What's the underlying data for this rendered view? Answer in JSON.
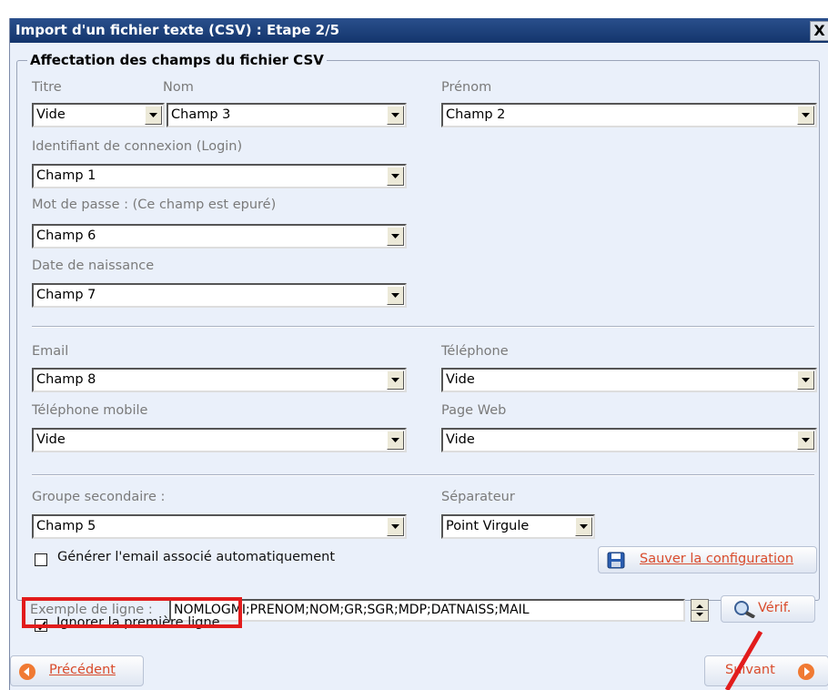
{
  "window": {
    "title": "Import d'un fichier texte (CSV) : Etape 2/5",
    "close_label": "X"
  },
  "group": {
    "legend": "Affectation des champs du fichier CSV"
  },
  "fields": {
    "titre": {
      "label": "Titre",
      "value": "Vide"
    },
    "nom": {
      "label": "Nom",
      "value": "Champ 3"
    },
    "prenom": {
      "label": "Prénom",
      "value": "Champ 2"
    },
    "login": {
      "label": "Identifiant de connexion (Login)",
      "value": "Champ 1"
    },
    "password": {
      "label": "Mot de passe : (Ce champ est epuré)",
      "value": "Champ 6"
    },
    "birthdate": {
      "label": "Date de naissance",
      "value": "Champ 7"
    },
    "email": {
      "label": "Email",
      "value": "Champ 8"
    },
    "telephone": {
      "label": "Téléphone",
      "value": "Vide"
    },
    "mobile": {
      "label": "Téléphone mobile",
      "value": "Vide"
    },
    "web": {
      "label": "Page Web",
      "value": "Vide"
    },
    "groupe": {
      "label": "Groupe secondaire :",
      "value": "Champ 5"
    },
    "separateur": {
      "label": "Séparateur",
      "value": "Point Virgule"
    }
  },
  "generate_email": {
    "label": "Générer l'email associé automatiquement",
    "checked": false
  },
  "save_config": {
    "label": "Sauver la configuration"
  },
  "example": {
    "label": "Exemple de ligne :",
    "value": "NOMLOGMI;PRENOM;NOM;GR;SGR;MDP;DATNAISS;MAIL"
  },
  "verify": {
    "label": "Vérif."
  },
  "ignore_first": {
    "label": "Ignorer la première ligne",
    "checked": true
  },
  "nav": {
    "previous": "Précédent",
    "next": "Suivant"
  },
  "colors": {
    "annotation": "#e21c1c",
    "title_bar": "#1c3f7a",
    "link_text": "#d94b2b"
  }
}
